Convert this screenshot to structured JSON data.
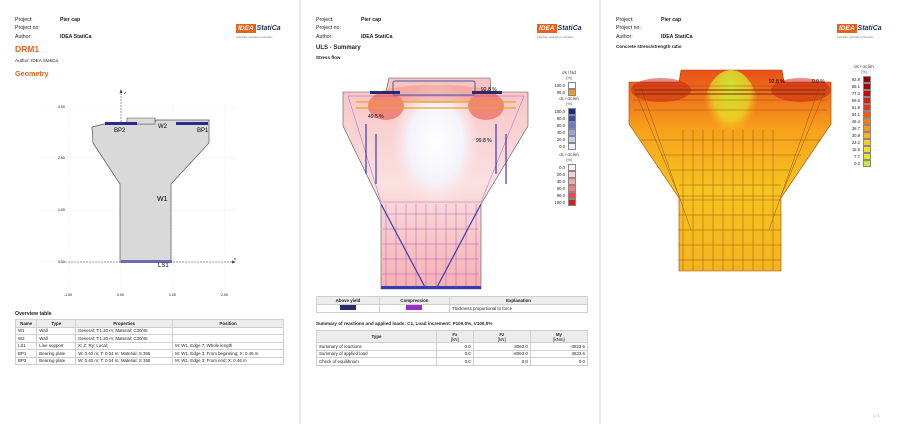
{
  "header": {
    "labels": {
      "project": "Project:",
      "project_no": "Project no:",
      "project_no_p2": "Project no:",
      "author": "Author:"
    },
    "project": "Pier cap",
    "project_no": "",
    "author": "IDEA StatiCa"
  },
  "logo": {
    "mark": "IDEA",
    "name": "StatiCa",
    "tag": "Calculate yesterday's estimates"
  },
  "page1": {
    "title": "DRM1",
    "author_line": "Author: IDEA StatiCa",
    "section": "Geometry",
    "drawing": {
      "labels": {
        "bp2": "BP2",
        "w2": "W2",
        "bp1": "BP1",
        "w1": "W1",
        "ls1": "LS1",
        "z": "z",
        "x": "x"
      },
      "y_ticks": [
        "3.00",
        "2.50",
        "1.00",
        "0.00"
      ],
      "x_ticks": [
        "-1.00",
        "0.00",
        "1.00",
        "2.00"
      ]
    },
    "table_title": "Overview table",
    "table": {
      "columns": [
        "Name",
        "Type",
        "Properties",
        "Position"
      ],
      "rows": [
        [
          "W1",
          "Wall",
          "General; T:1.20 m; Material: C30/45",
          ""
        ],
        [
          "W2",
          "Wall",
          "General; T:1.20 m; Material: C30/45",
          ""
        ],
        [
          "LS1",
          "Line support",
          "X; Z; Ry; Local;",
          "M: W1, Edge 7; Whole length"
        ],
        [
          "BP1",
          "Bearing plate",
          "W: 0.40 m; T: 0.04 m; Material: S 355",
          "M: W1, Edge 3; From beginning; X: 0.46 m"
        ],
        [
          "BP2",
          "Bearing plate",
          "W: 0.40 m; T: 0.04 m; Material: S 355",
          "M: W1, Edge 3; From end; X: 0.46 m"
        ]
      ]
    }
  },
  "page2": {
    "title": "ULS - Summary",
    "subtitle": "Stress flow",
    "annotations": {
      "a1": "92.8 %",
      "a2": "49.5 %",
      "a3": "99.8 %"
    },
    "legend_fy": {
      "title": "σs / fsd",
      "unit": "[%]",
      "rows": [
        "100.0",
        "95.0"
      ],
      "colors": [
        "#ffffff",
        "#f0a020"
      ]
    },
    "legend_fs": {
      "title": "σc / σc,lim",
      "unit": "[%]",
      "rows": [
        "100.0",
        "80.0",
        "60.0",
        "40.0",
        "20.0",
        "0.0"
      ],
      "colors": [
        "#1a2a80",
        "#3a4aa8",
        "#6a78c8",
        "#9aa4dc",
        "#c6cdee",
        "#eef0fa"
      ]
    },
    "legend_fc": {
      "title": "σc / σc,lim",
      "unit": "[%]",
      "rows": [
        "0.0",
        "20.0",
        "40.0",
        "60.0",
        "80.0",
        "100.0"
      ],
      "colors": [
        "#fff4f4",
        "#fcd0d0",
        "#f9a8a8",
        "#f47b7b",
        "#ea4a4a",
        "#d61e1e"
      ]
    },
    "key_table": {
      "columns": [
        "Above yield",
        "Compression",
        "Explanation"
      ],
      "row": [
        "",
        "",
        "Thickness proportional to force"
      ],
      "colors": [
        "#2b2a6b",
        "#9b2ec6"
      ]
    },
    "summary_title": "Summary of reactions and applied loads: C1, Load increment: P100.0%, V100.0%",
    "summary": {
      "columns": [
        "Type",
        "Fx",
        "Fz",
        "My"
      ],
      "units": [
        "",
        "[kN]",
        "[kN]",
        "[kNm]"
      ],
      "rows": [
        [
          "Summary of reactions",
          "0.0",
          "8063.0",
          "-3823.6"
        ],
        [
          "Summary of applied load",
          "0.0",
          "-8063.0",
          "3823.6"
        ],
        [
          "Check of equilibrium",
          "0.0",
          "0.0",
          "0.0"
        ]
      ]
    }
  },
  "page3": {
    "subtitle": "Concrete stress/strength ratio",
    "annotations": {
      "a1": "92.8 %",
      "a2": "0.0 %"
    },
    "legend": {
      "title": "σc / σc,lim",
      "unit": "[%]",
      "rows": [
        "92.8",
        "85.1",
        "77.3",
        "69.6",
        "61.9",
        "54.1",
        "46.4",
        "38.7",
        "30.9",
        "23.2",
        "15.5",
        "7.7",
        "0.0"
      ],
      "colors": [
        "#8b0000",
        "#a80000",
        "#c40a0a",
        "#dc1e10",
        "#e83a12",
        "#f05a14",
        "#f47a16",
        "#f79a1a",
        "#f9b41e",
        "#f9cc22",
        "#f3de26",
        "#dfe62c",
        "#c8e632"
      ]
    }
  },
  "footer": {
    "page3_mark": "1 / 1"
  }
}
